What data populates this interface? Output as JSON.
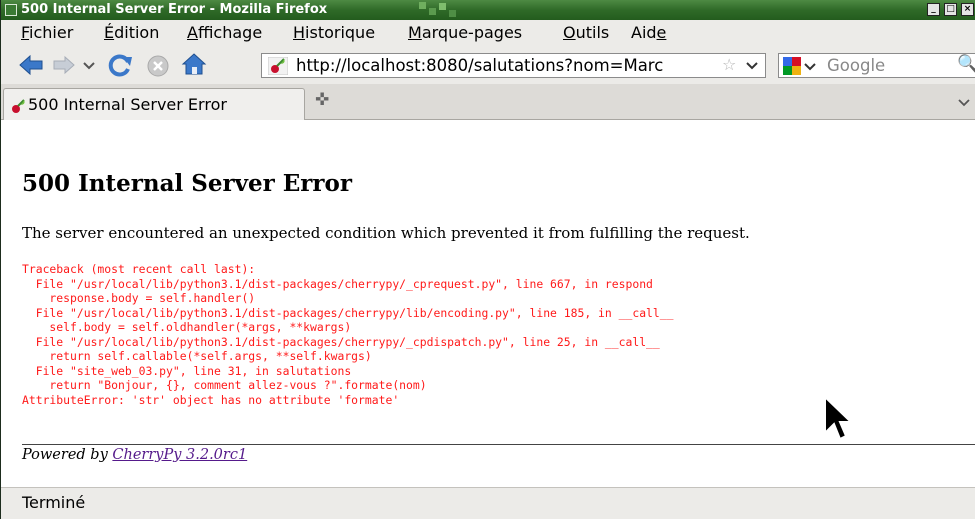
{
  "window": {
    "title": "500 Internal Server Error - Mozilla Firefox",
    "controls": [
      "minimize-icon",
      "maximize-icon",
      "close-icon"
    ]
  },
  "menubar": {
    "items": [
      {
        "pre": "",
        "key": "F",
        "post": "ichier"
      },
      {
        "pre": "",
        "key": "É",
        "post": "dition"
      },
      {
        "pre": "",
        "key": "A",
        "post": "ffichage"
      },
      {
        "pre": "",
        "key": "H",
        "post": "istorique"
      },
      {
        "pre": "",
        "key": "M",
        "post": "arque-pages"
      },
      {
        "pre": "",
        "key": "O",
        "post": "utils"
      },
      {
        "pre": "Aid",
        "key": "e",
        "post": ""
      }
    ]
  },
  "toolbar": {
    "icons": [
      "back-arrow-icon",
      "forward-arrow-icon",
      "history-dropdown-icon",
      "reload-icon",
      "stop-icon",
      "home-icon"
    ],
    "url": "http://localhost:8080/salutations?nom=Marc",
    "search_placeholder": "Google",
    "search_engine_icon": "google-logo-icon"
  },
  "tabs": [
    {
      "label": "500 Internal Server Error",
      "icon": "cherrypy-favicon-icon",
      "active": true
    }
  ],
  "page": {
    "heading": "500 Internal Server Error",
    "message": "The server encountered an unexpected condition which prevented it from fulfilling the request.",
    "traceback": "Traceback (most recent call last):\n  File \"/usr/local/lib/python3.1/dist-packages/cherrypy/_cprequest.py\", line 667, in respond\n    response.body = self.handler()\n  File \"/usr/local/lib/python3.1/dist-packages/cherrypy/lib/encoding.py\", line 185, in __call__\n    self.body = self.oldhandler(*args, **kwargs)\n  File \"/usr/local/lib/python3.1/dist-packages/cherrypy/_cpdispatch.py\", line 25, in __call__\n    return self.callable(*self.args, **self.kwargs)\n  File \"site_web_03.py\", line 31, in salutations\n    return \"Bonjour, {}, comment allez-vous ?\".formate(nom)\nAttributeError: 'str' object has no attribute 'formate'",
    "footer_prefix": "Powered by",
    "footer_link": "CherryPy 3.2.0rc1"
  },
  "status": {
    "text": "Terminé"
  },
  "colors": {
    "titlebar": "#2f6a28",
    "chrome": "#ecebe8",
    "traceback": "#ff1a1a",
    "link": "#551a8b",
    "nav_blue": "#3b78c9"
  }
}
